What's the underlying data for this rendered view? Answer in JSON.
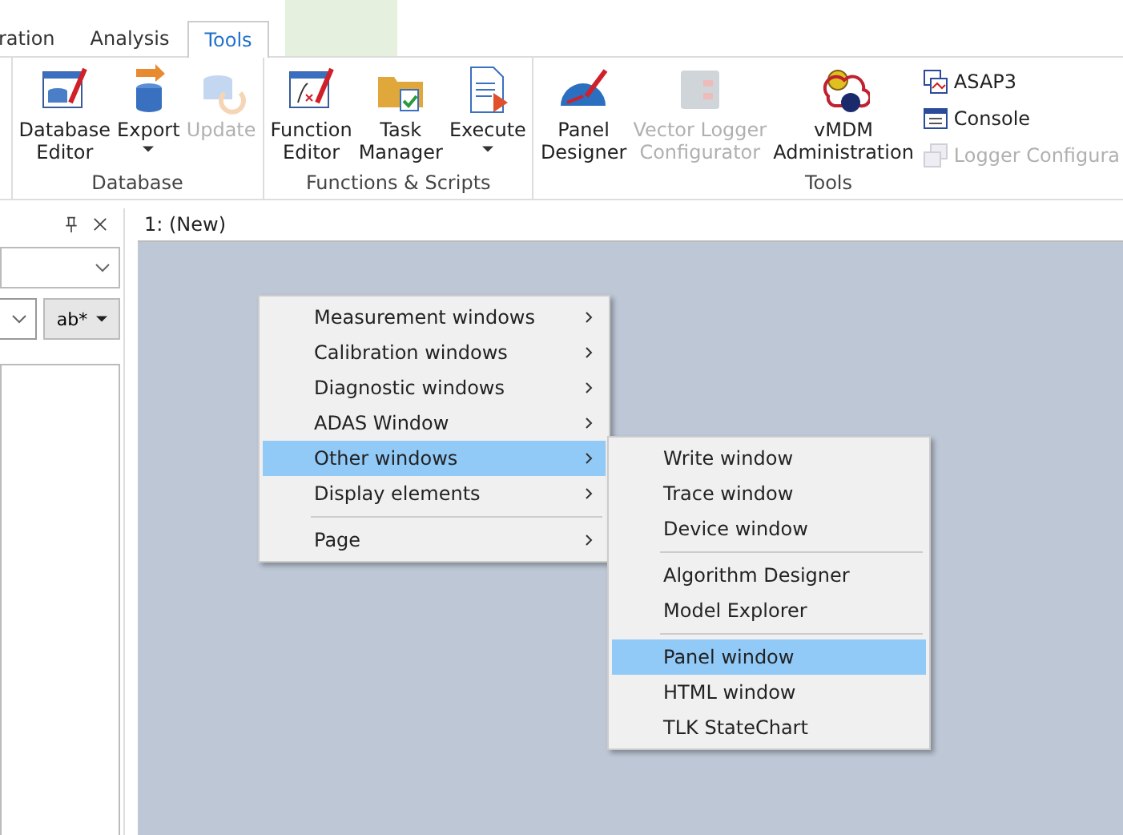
{
  "ribbon_tabs": [
    {
      "label": "ration",
      "selected": false
    },
    {
      "label": "Analysis",
      "selected": false
    },
    {
      "label": "Tools",
      "selected": true
    }
  ],
  "ribbon_groups": [
    {
      "label": "Database",
      "buttons": [
        {
          "lines": [
            "Database",
            "Editor"
          ],
          "disabled": false,
          "dropdown": false
        },
        {
          "lines": [
            "Export"
          ],
          "disabled": false,
          "dropdown": true
        },
        {
          "lines": [
            "Update"
          ],
          "disabled": true,
          "dropdown": false
        }
      ]
    },
    {
      "label": "Functions & Scripts",
      "buttons": [
        {
          "lines": [
            "Function",
            "Editor"
          ],
          "disabled": false,
          "dropdown": false
        },
        {
          "lines": [
            "Task",
            "Manager"
          ],
          "disabled": false,
          "dropdown": false
        },
        {
          "lines": [
            "Execute"
          ],
          "disabled": false,
          "dropdown": true
        }
      ]
    },
    {
      "label": "Tools",
      "buttons": [
        {
          "lines": [
            "Panel",
            "Designer"
          ],
          "disabled": false,
          "dropdown": false
        },
        {
          "lines": [
            "Vector Logger",
            "Configurator"
          ],
          "disabled": true,
          "dropdown": false
        },
        {
          "lines": [
            "vMDM",
            "Administration"
          ],
          "disabled": false,
          "dropdown": false
        }
      ],
      "small_buttons": [
        {
          "label": "ASAP3",
          "disabled": false
        },
        {
          "label": "Console",
          "disabled": false
        },
        {
          "label": "Logger Configura",
          "disabled": true
        }
      ]
    }
  ],
  "left_panel": {
    "filter_button": "ab*"
  },
  "document_tab": {
    "label": "1: (New)",
    "selected": true
  },
  "context_menu": {
    "items": [
      {
        "kind": "item",
        "label": "Measurement windows",
        "submenu": true,
        "selected": false
      },
      {
        "kind": "item",
        "label": "Calibration windows",
        "submenu": true,
        "selected": false
      },
      {
        "kind": "item",
        "label": "Diagnostic windows",
        "submenu": true,
        "selected": false
      },
      {
        "kind": "item",
        "label": "ADAS Window",
        "submenu": true,
        "selected": false
      },
      {
        "kind": "item",
        "label": "Other windows",
        "submenu": true,
        "selected": true
      },
      {
        "kind": "item",
        "label": "Display elements",
        "submenu": true,
        "selected": false
      },
      {
        "kind": "separator"
      },
      {
        "kind": "item",
        "label": "Page",
        "submenu": true,
        "selected": false
      }
    ]
  },
  "submenu": {
    "items": [
      {
        "kind": "item",
        "label": "Write window",
        "selected": false
      },
      {
        "kind": "item",
        "label": "Trace window",
        "selected": false
      },
      {
        "kind": "item",
        "label": "Device window",
        "selected": false
      },
      {
        "kind": "separator"
      },
      {
        "kind": "item",
        "label": "Algorithm Designer",
        "selected": false
      },
      {
        "kind": "item",
        "label": "Model Explorer",
        "selected": false
      },
      {
        "kind": "separator"
      },
      {
        "kind": "item",
        "label": "Panel window",
        "selected": true
      },
      {
        "kind": "item",
        "label": "HTML window",
        "selected": false
      },
      {
        "kind": "item",
        "label": "TLK StateChart",
        "selected": false
      }
    ]
  }
}
